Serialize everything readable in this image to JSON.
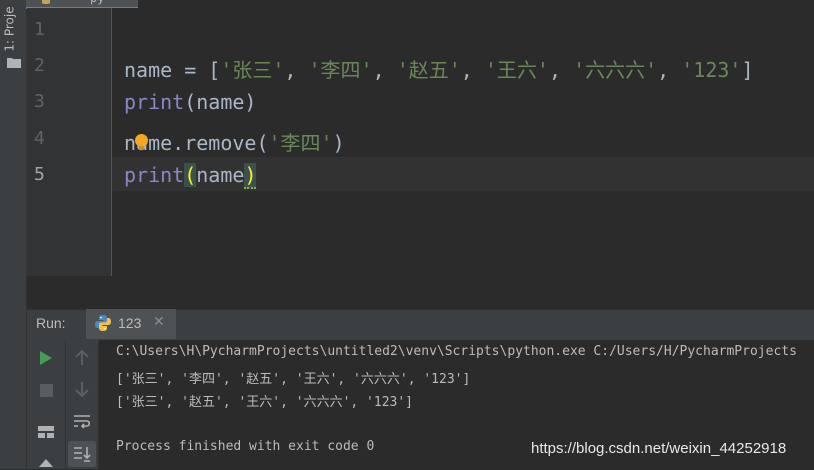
{
  "sidebar": {
    "project_label": "1: Proje"
  },
  "top_tab": {
    "label": "py"
  },
  "editor": {
    "line_numbers": [
      "1",
      "2",
      "3",
      "4",
      "5"
    ],
    "lines": [
      {
        "parts": []
      },
      {
        "parts": [
          {
            "t": "name = [",
            "c": "default"
          },
          {
            "t": "'张三'",
            "c": "string"
          },
          {
            "t": ", ",
            "c": "default"
          },
          {
            "t": "'李四'",
            "c": "string"
          },
          {
            "t": ", ",
            "c": "default"
          },
          {
            "t": "'赵五'",
            "c": "string"
          },
          {
            "t": ", ",
            "c": "default"
          },
          {
            "t": "'王六'",
            "c": "string"
          },
          {
            "t": ", ",
            "c": "default"
          },
          {
            "t": "'六六六'",
            "c": "string"
          },
          {
            "t": ", ",
            "c": "default"
          },
          {
            "t": "'123'",
            "c": "string"
          },
          {
            "t": "]",
            "c": "default"
          }
        ]
      },
      {
        "parts": [
          {
            "t": "print",
            "c": "builtin"
          },
          {
            "t": "(name)",
            "c": "default"
          }
        ]
      },
      {
        "parts": [
          {
            "t": "name.remove(",
            "c": "default"
          },
          {
            "t": "'李四'",
            "c": "string"
          },
          {
            "t": ")",
            "c": "default"
          }
        ]
      },
      {
        "parts": [
          {
            "t": "print",
            "c": "builtin"
          },
          {
            "t": "(",
            "c": "paren"
          },
          {
            "t": "name",
            "c": "default"
          },
          {
            "t": ")",
            "c": "paren-squiggle"
          }
        ]
      }
    ]
  },
  "run_panel": {
    "label": "Run:",
    "tab_label": "123",
    "output": [
      "C:\\Users\\H\\PycharmProjects\\untitled2\\venv\\Scripts\\python.exe C:/Users/H/PycharmProjects",
      "['张三', '李四', '赵五', '王六', '六六六', '123']",
      "['张三', '赵五', '王六', '六六六', '123']",
      "",
      "Process finished with exit code 0"
    ]
  },
  "watermark": "https://blog.csdn.net/weixin_44252918",
  "colors": {
    "string": "#6a8759",
    "builtin": "#8888c6",
    "default": "#a9b7c6",
    "accent": "#4a88c7"
  }
}
